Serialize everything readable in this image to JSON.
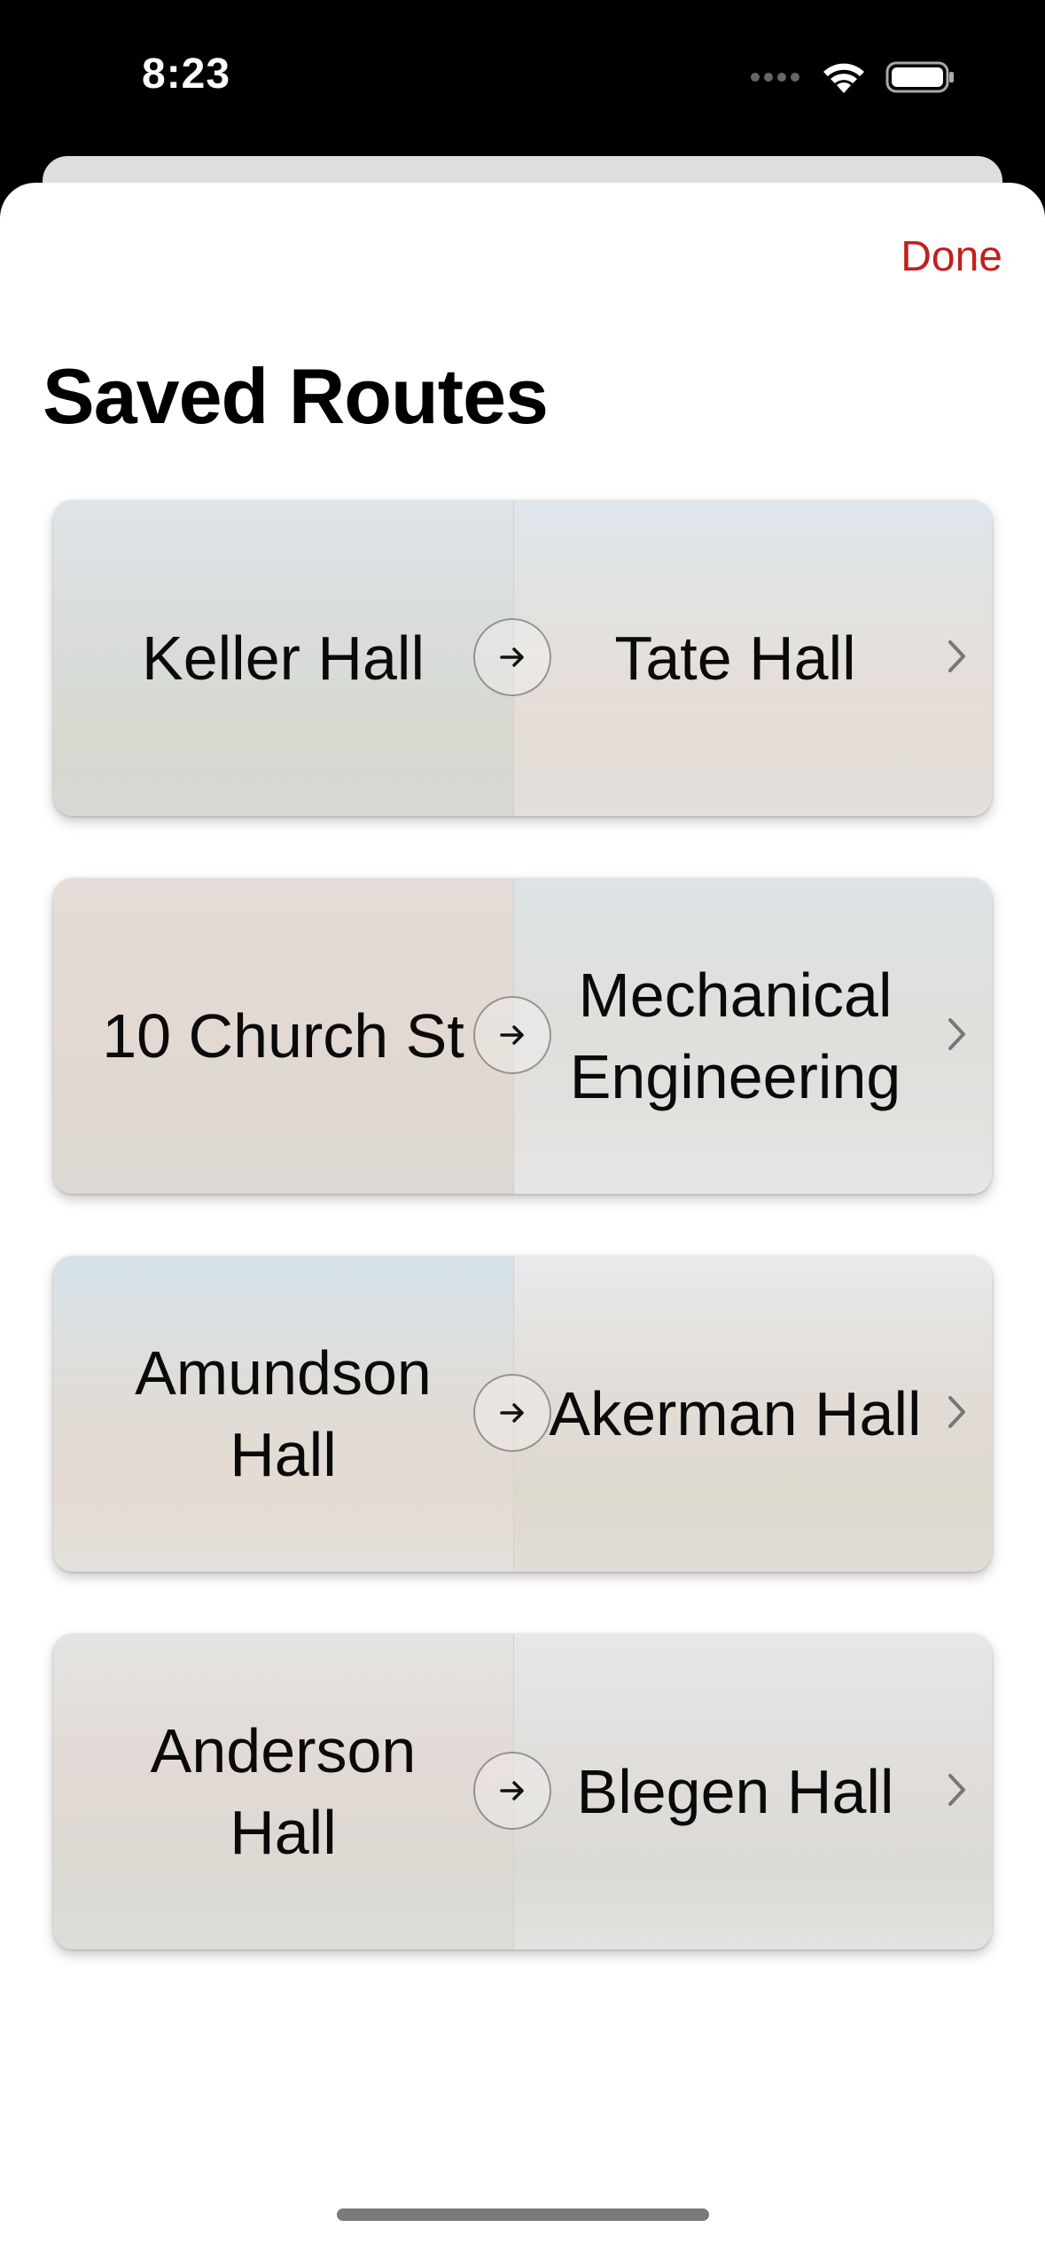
{
  "status_bar": {
    "time": "8:23",
    "icons": [
      "cellular-dots-icon",
      "wifi-icon",
      "battery-icon"
    ]
  },
  "sheet": {
    "done_label": "Done",
    "title": "Saved Routes",
    "accent_color": "#c0201c"
  },
  "routes": [
    {
      "from": "Keller Hall",
      "to": "Tate Hall"
    },
    {
      "from": "10 Church St",
      "to": "Mechanical Engineering"
    },
    {
      "from": "Amundson Hall",
      "to": "Akerman Hall"
    },
    {
      "from": "Anderson Hall",
      "to": "Blegen Hall"
    }
  ]
}
